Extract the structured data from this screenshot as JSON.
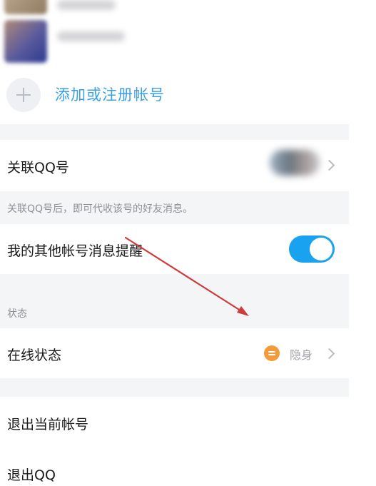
{
  "accounts": {
    "add_label": "添加或注册帐号"
  },
  "linked_qq": {
    "label": "关联QQ号",
    "note": "关联QQ号后，即可代收该号的好友消息。"
  },
  "other_accounts": {
    "label": "我的其他帐号消息提醒",
    "toggle_on": true,
    "toggle_color": "#19a2f0"
  },
  "status_section": {
    "title": "状态",
    "online_status_label": "在线状态",
    "online_status_value": "隐身",
    "badge_color": "#f39a3b"
  },
  "actions": {
    "logout_account": "退出当前帐号",
    "quit_qq": "退出QQ"
  },
  "annotation": {
    "arrow_color": "#d03a3a"
  }
}
